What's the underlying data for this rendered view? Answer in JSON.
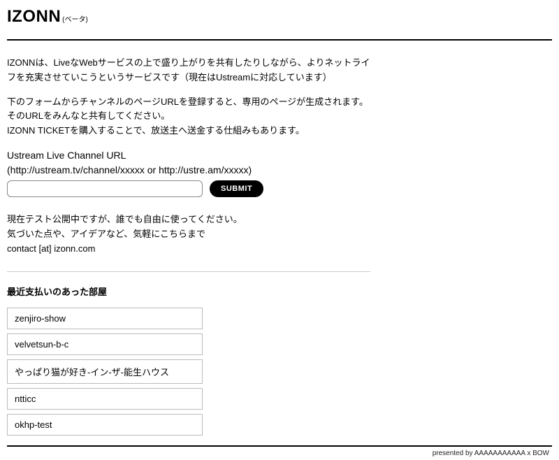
{
  "header": {
    "title": "IZONN",
    "suffix": "(ベータ)"
  },
  "intro": {
    "p1": "IZONNは、LiveなWebサービスの上で盛り上がりを共有したりしながら、よりネットライフを充実させていこうというサービスです（現在はUstreamに対応しています）",
    "p2": "下のフォームからチャンネルのページURLを登録すると、専用のページが生成されます。\nそのURLをみんなと共有してください。\nIZONN TICKETを購入することで、放送主へ送金する仕組みもあります。"
  },
  "form": {
    "label_line1": "Ustream Live Channel URL",
    "label_line2": "(http://ustream.tv/channel/xxxxx or http://ustre.am/xxxxx)",
    "input_value": "",
    "submit_label": "SUBMIT"
  },
  "notice": {
    "text": "現在テスト公開中ですが、誰でも自由に使ってください。\n気づいた点や、アイデアなど、気軽にこちらまで\ncontact [at] izonn.com"
  },
  "rooms": {
    "heading": "最近支払いのあった部屋",
    "items": [
      "zenjiro-show",
      "velvetsun-b-c",
      "やっぱり猫が好き-イン-ザ-能生ハウス",
      "ntticc",
      "okhp-test"
    ]
  },
  "footer": {
    "text": "presented by AAAAAAAAAAA x BOW"
  }
}
